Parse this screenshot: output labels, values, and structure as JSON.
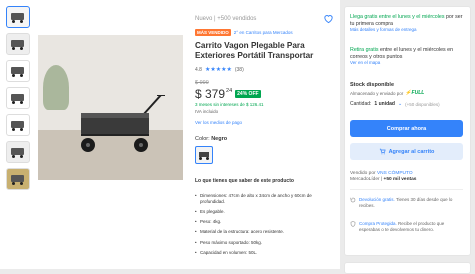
{
  "meta": {
    "condition_sales": "Nuevo  |  +500 vendidos"
  },
  "badges": {
    "top": "MÁS VENDIDO",
    "rank": "2° en Carritos para Mercados"
  },
  "product": {
    "title": "Carrito Vagon Plegable Para Exteriores Portátil Transportar",
    "rating": "4.8",
    "reviews": "(38)",
    "old_price": "$ 999",
    "price": "$ 379",
    "cents": "24",
    "discount": "24% OFF",
    "installments": "3 meses sin intereses de $ 126.41",
    "iva": "IVA incluido",
    "payment_link": "Ver los medios de pago",
    "color_label": "Color:",
    "color_value": "Negro"
  },
  "features": {
    "title": "Lo que tienes que saber de este producto",
    "items": [
      "Dimensiones: 47cm de alto x 34cm de ancho y 60cm de profundidad.",
      "Es plegable.",
      "Peso: 4kg.",
      "Material de la estructura: acero resistente.",
      "Peso máximo soportado: 50kg.",
      "Capacidad en volumen: 50L."
    ]
  },
  "sidebar": {
    "ship_free_1": "Llega gratis",
    "ship_text_1a": " entre el lunes y el miércoles",
    "ship_text_1b": " por ser tu primera compra",
    "ship_link_1": "Más detalles y formas de entrega",
    "ship_free_2": "Retira gratis",
    "ship_text_2": " entre el lunes y el miércoles en correos y otros puntos",
    "ship_link_2": "Ver en el mapa",
    "stock": "Stock disponible",
    "stored": "Almacenado y enviado por",
    "full": "⚡FULL",
    "qty_label": "Cantidad:",
    "qty_value": "1 unidad",
    "qty_avail": "(+50 disponibles)",
    "buy": "Comprar ahora",
    "cart": "Agregar al carrito",
    "sold_by": "Vendido por",
    "seller": "VNS CÓMPUTO",
    "seller_tier": "MercadoLíder",
    "seller_sales": "+50 mil ventas",
    "return_link": "Devolución gratis.",
    "return_text": " Tienes 30 días desde que lo recibes.",
    "protect_link": "Compra Protegida.",
    "protect_text": " Recibe el producto que esperabas o te devolvemos tu dinero."
  },
  "colors": {
    "accent": "#3483fa",
    "green": "#00a650",
    "badge": "#ff7733"
  }
}
